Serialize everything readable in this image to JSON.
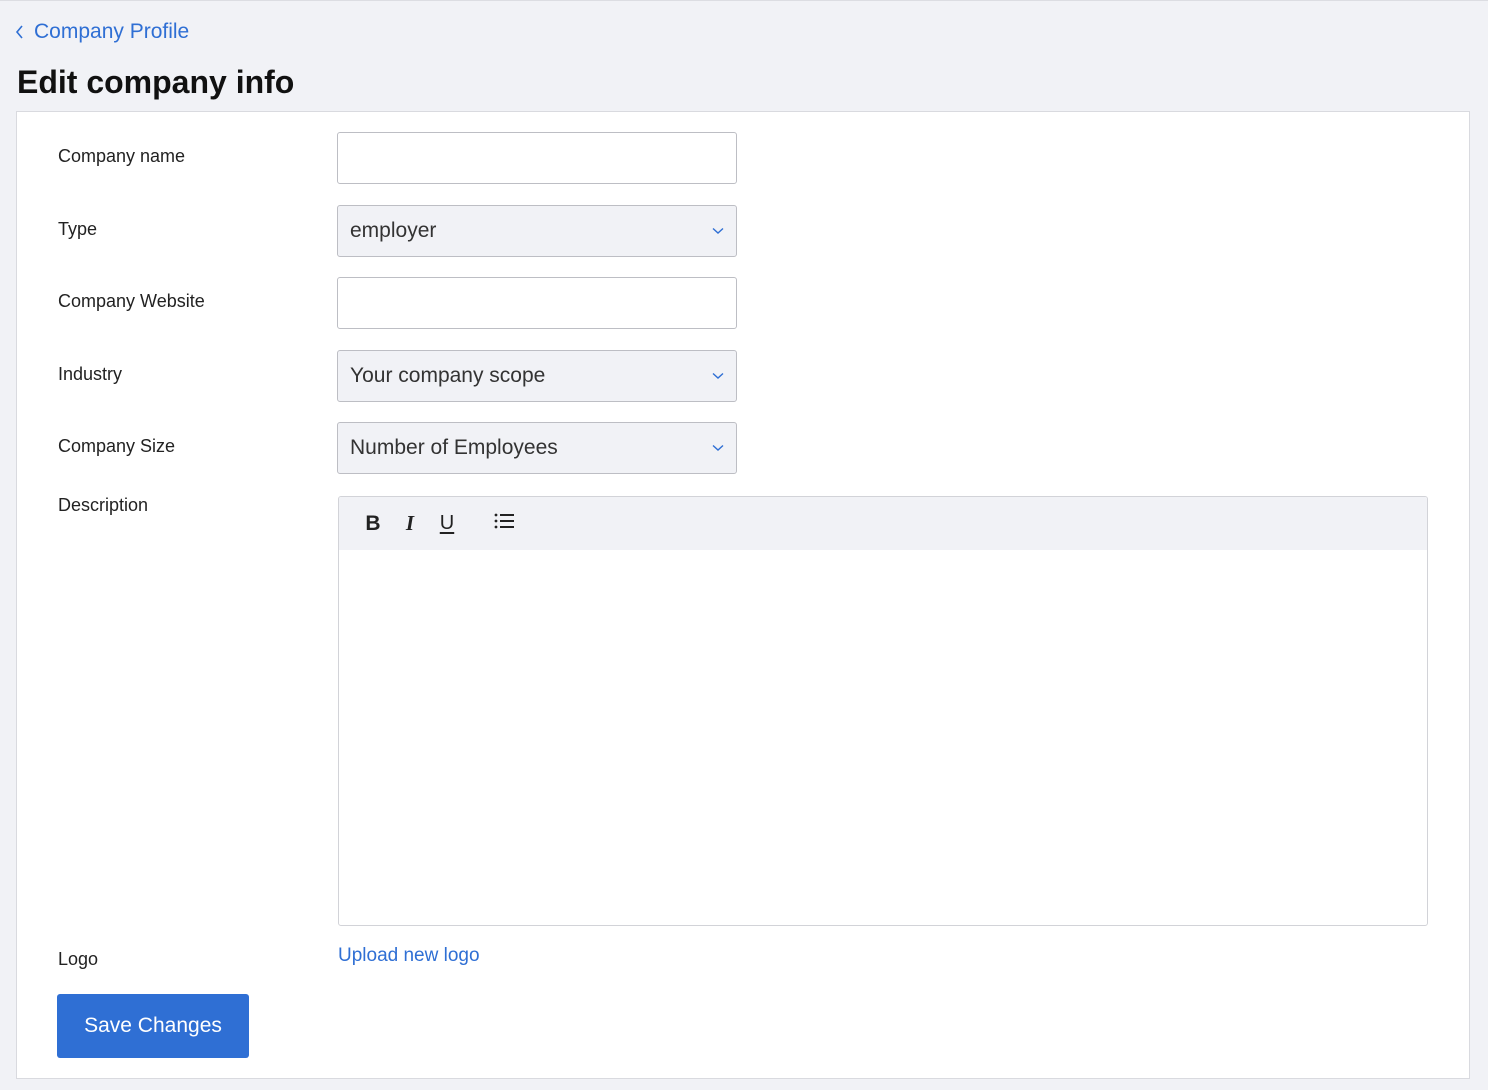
{
  "breadcrumb": {
    "label": "Company Profile"
  },
  "page": {
    "title": "Edit company info"
  },
  "form": {
    "company_name": {
      "label": "Company name",
      "value": "",
      "placeholder": ""
    },
    "type": {
      "label": "Type",
      "selected": "employer"
    },
    "website": {
      "label": "Company Website",
      "value": "",
      "placeholder": ""
    },
    "industry": {
      "label": "Industry",
      "selected": "Your company scope"
    },
    "size": {
      "label": "Company Size",
      "selected": "Number of Employees"
    },
    "description": {
      "label": "Description",
      "toolbar": {
        "bold": "B",
        "italic": "I",
        "underline": "U",
        "list_icon": "bullet-list-icon"
      },
      "value": ""
    },
    "logo": {
      "label": "Logo",
      "upload_label": "Upload new logo"
    },
    "save_label": "Save Changes"
  },
  "colors": {
    "accent": "#2f6fd4",
    "background": "#f1f2f6",
    "card": "#ffffff"
  }
}
